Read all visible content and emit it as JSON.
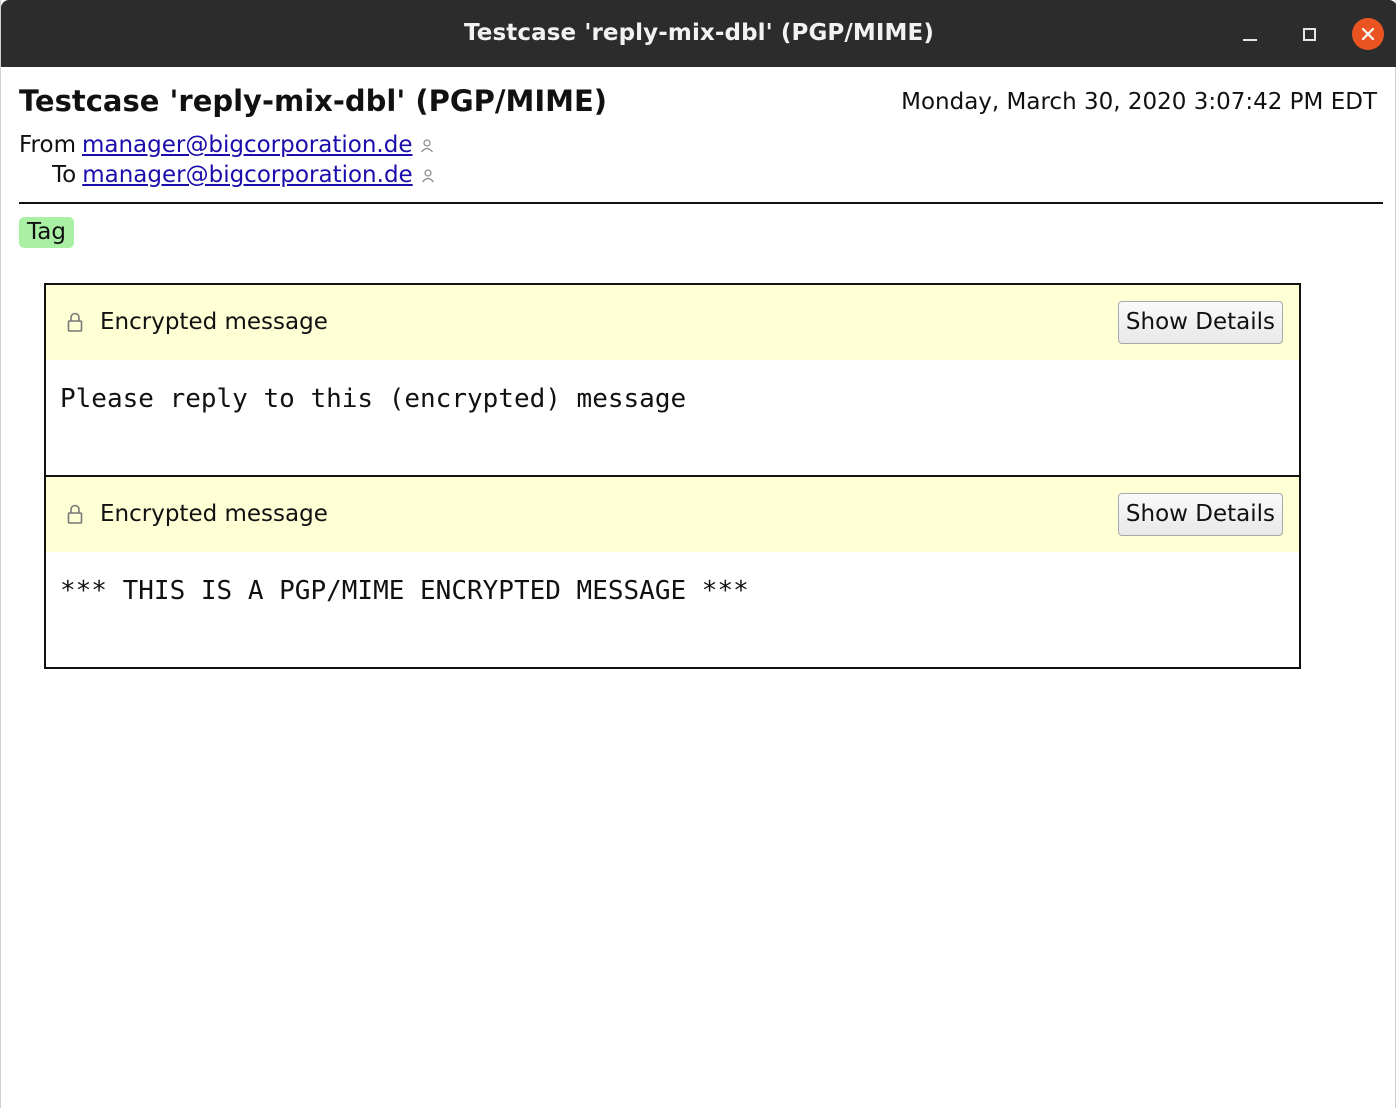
{
  "window": {
    "title": "Testcase 'reply-mix-dbl' (PGP/MIME)"
  },
  "message": {
    "subject": "Testcase 'reply-mix-dbl' (PGP/MIME)",
    "date": "Monday, March 30, 2020 3:07:42 PM EDT",
    "from_label": "From",
    "from_address": "manager@bigcorporation.de",
    "to_label": "To",
    "to_address": "manager@bigcorporation.de",
    "tag": "Tag",
    "tag_color": "#a9f0a4"
  },
  "encrypted_parts": [
    {
      "label": "Encrypted message",
      "button": "Show Details",
      "body": "Please reply to this (encrypted) message"
    },
    {
      "label": "Encrypted message",
      "button": "Show Details",
      "body": "*** THIS IS A PGP/MIME ENCRYPTED MESSAGE ***"
    }
  ],
  "icons": {
    "lock": "lock-icon",
    "person": "person-icon",
    "close": "close-icon",
    "minimize": "minimize-icon",
    "maximize": "maximize-icon"
  },
  "colors": {
    "titlebar": "#2c2c2c",
    "close_button": "#e95420",
    "encrypted_header_bg": "#ffffd6",
    "link": "#1a0dab"
  }
}
